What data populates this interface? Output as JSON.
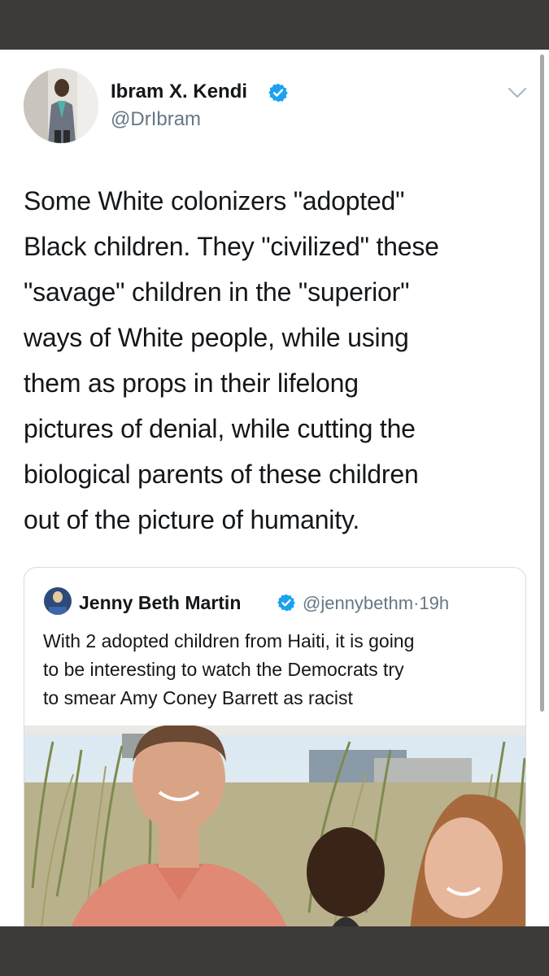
{
  "tweet": {
    "author_name": "Ibram X. Kendi",
    "author_handle": "@DrIbram",
    "text": "Some White colonizers \"adopted\"\nBlack children. They \"civilized\" these\n\"savage\" children in the \"superior\"\nways of White people, while using\nthem as props in their lifelong\npictures of denial, while cutting the\nbiological parents of these children\nout of the picture of humanity."
  },
  "quoted_tweet": {
    "author_name": "Jenny Beth Martin",
    "author_handle": "@jennybethm",
    "separator": "·",
    "time": "19h",
    "text": "With 2 adopted children from Haiti, it is going\nto be interesting to watch the Democrats try\nto smear Amy Coney Barrett as racist"
  },
  "colors": {
    "frame": "#3e3a39",
    "verified_blue": "#1da1f2",
    "text_primary": "#14171a",
    "text_secondary": "#657786",
    "border": "#d6dce1"
  },
  "icons": {
    "verified": "verified-badge-icon",
    "menu": "chevron-down-icon"
  }
}
